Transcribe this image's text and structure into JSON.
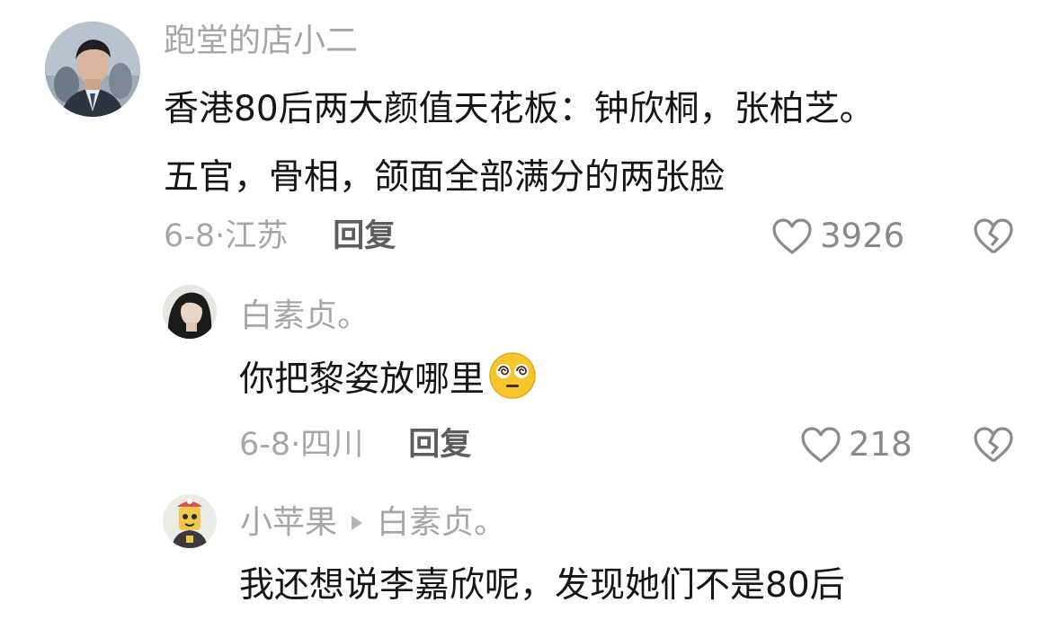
{
  "comments": [
    {
      "username": "跑堂的店小二",
      "lines": [
        "香港80后两大颜值天花板：钟欣桐，张柏芝。",
        "五官，骨相，颌面全部满分的两张脸"
      ],
      "date_location": "6-8·江苏",
      "reply_label": "回复",
      "likes": "3926",
      "avatar_icon": "man-in-suit-avatar"
    },
    {
      "username": "白素贞。",
      "lines": [
        "你把黎姿放哪里"
      ],
      "emoji": "dizzy-face-emoji",
      "date_location": "6-8·四川",
      "reply_label": "回复",
      "likes": "218",
      "avatar_icon": "dark-hair-avatar"
    },
    {
      "username": "小苹果",
      "reply_to": "白素贞。",
      "lines": [
        "我还想说李嘉欣呢，发现她们不是80后"
      ],
      "avatar_icon": "costume-character-avatar"
    }
  ],
  "colors": {
    "username": "#a6a6a6",
    "body_text": "#161616",
    "reply": "#5d5d5d",
    "icon": "#8a8a8a"
  },
  "icons": {
    "like": "heart-outline-icon",
    "dislike": "broken-heart-icon",
    "reply_arrow": "triangle-right-icon"
  }
}
